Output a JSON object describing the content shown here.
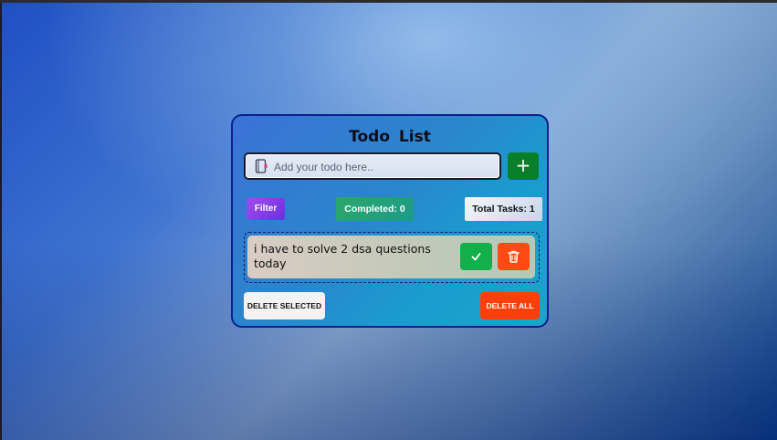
{
  "app": {
    "title": "Todo  List"
  },
  "input": {
    "placeholder": "Add your todo here..",
    "value": "",
    "icon": "notebook-icon"
  },
  "add_button": {
    "label": "+",
    "color": "#0a7f2a"
  },
  "toolbar": {
    "filter_label": "Filter",
    "completed_label": "Completed: 0",
    "total_label": "Total Tasks: 1"
  },
  "todos": [
    {
      "text": "i have to solve 2 dsa questions today",
      "done_icon": "check-icon",
      "delete_icon": "trash-icon"
    }
  ],
  "footer": {
    "delete_selected_label": "DELETE SELECTED",
    "delete_all_label": "DELETE ALL"
  },
  "colors": {
    "card_border": "#0b1f8f",
    "done_button": "#12b04a",
    "delete_button": "#ff4a12",
    "delete_all": "#ff3f0a"
  }
}
